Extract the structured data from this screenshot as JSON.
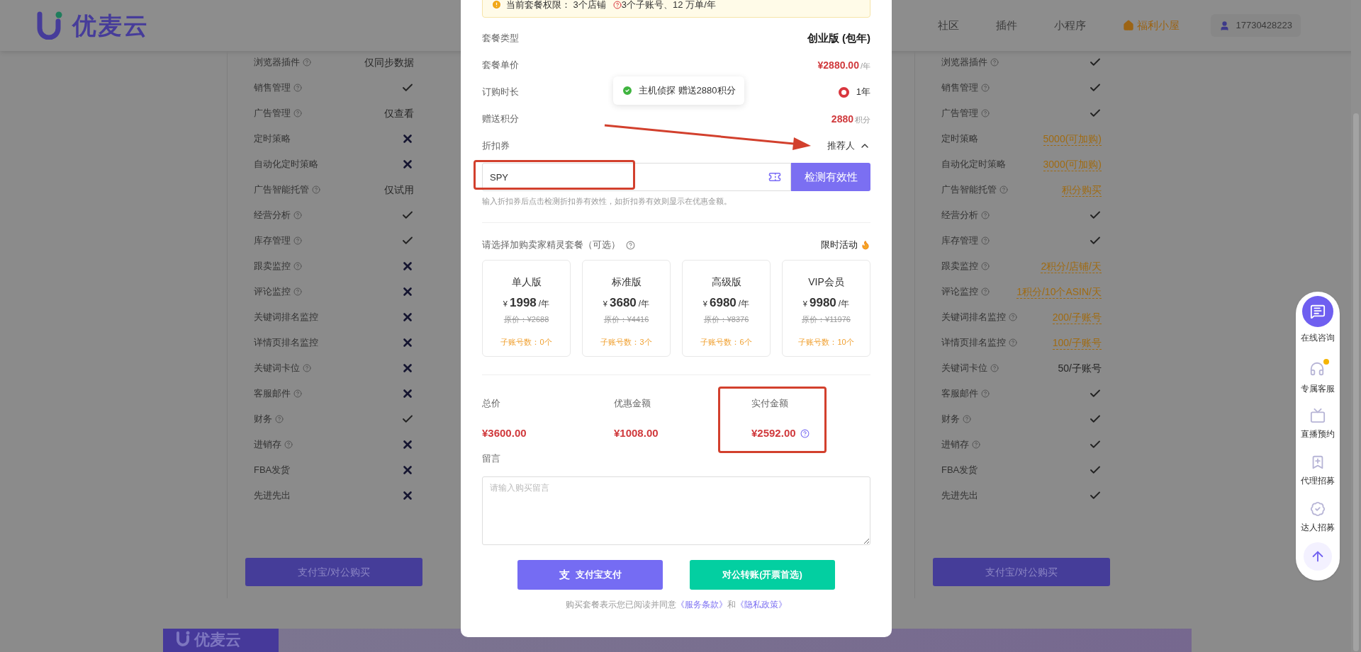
{
  "header": {
    "logo": "优麦云",
    "nav": [
      {
        "label": "社区",
        "kind": "plain"
      },
      {
        "label": "插件",
        "kind": "plain"
      },
      {
        "label": "小程序",
        "kind": "plain"
      },
      {
        "label": "福利小屋",
        "kind": "highlight"
      }
    ],
    "user": "17730428223"
  },
  "plans": [
    {
      "features": [
        {
          "label": "浏览器插件",
          "help": true,
          "kind": "text",
          "value": "仅同步数据"
        },
        {
          "label": "销售管理",
          "help": true,
          "kind": "check"
        },
        {
          "label": "广告管理",
          "help": true,
          "kind": "text",
          "value": "仅查看"
        },
        {
          "label": "定时策略",
          "help": false,
          "kind": "cross"
        },
        {
          "label": "自动化定时策略",
          "help": false,
          "kind": "cross"
        },
        {
          "label": "广告智能托管",
          "help": true,
          "kind": "text",
          "value": "仅试用"
        },
        {
          "label": "经营分析",
          "help": true,
          "kind": "check"
        },
        {
          "label": "库存管理",
          "help": true,
          "kind": "check"
        },
        {
          "label": "跟卖监控",
          "help": true,
          "kind": "cross"
        },
        {
          "label": "评论监控",
          "help": true,
          "kind": "cross"
        },
        {
          "label": "关键词排名监控",
          "help": false,
          "kind": "cross"
        },
        {
          "label": "详情页排名监控",
          "help": false,
          "kind": "cross"
        },
        {
          "label": "关键词卡位",
          "help": true,
          "kind": "cross"
        },
        {
          "label": "客服邮件",
          "help": true,
          "kind": "cross"
        },
        {
          "label": "财务",
          "help": true,
          "kind": "check"
        },
        {
          "label": "进销存",
          "help": true,
          "kind": "cross"
        },
        {
          "label": "FBA发货",
          "help": false,
          "kind": "cross"
        },
        {
          "label": "先进先出",
          "help": false,
          "kind": "cross"
        }
      ],
      "button": "支付宝/对公购买"
    },
    {
      "features": [
        {
          "label": "浏览器插件",
          "help": true,
          "kind": "check"
        },
        {
          "label": "销售管理",
          "help": true,
          "kind": "check"
        },
        {
          "label": "广告管理",
          "help": true,
          "kind": "check"
        },
        {
          "label": "定时策略",
          "help": false,
          "kind": "link",
          "value": "5000(可加购)"
        },
        {
          "label": "自动化定时策略",
          "help": false,
          "kind": "link",
          "value": "3000(可加购)"
        },
        {
          "label": "广告智能托管",
          "help": true,
          "kind": "link",
          "value": "积分购买"
        },
        {
          "label": "经营分析",
          "help": true,
          "kind": "check"
        },
        {
          "label": "库存管理",
          "help": true,
          "kind": "check"
        },
        {
          "label": "跟卖监控",
          "help": true,
          "kind": "link",
          "value": "2积分/店铺/天"
        },
        {
          "label": "评论监控",
          "help": true,
          "kind": "link",
          "value": "1积分/10个ASIN/天"
        },
        {
          "label": "关键词排名监控",
          "help": true,
          "kind": "link",
          "value": "200/子账号"
        },
        {
          "label": "详情页排名监控",
          "help": true,
          "kind": "link",
          "value": "100/子账号"
        },
        {
          "label": "关键词卡位",
          "help": true,
          "kind": "text",
          "value": "50/子账号"
        },
        {
          "label": "客服邮件",
          "help": true,
          "kind": "check"
        },
        {
          "label": "财务",
          "help": true,
          "kind": "check"
        },
        {
          "label": "进销存",
          "help": true,
          "kind": "check"
        },
        {
          "label": "FBA发货",
          "help": false,
          "kind": "check"
        },
        {
          "label": "先进先出",
          "help": false,
          "kind": "check"
        }
      ],
      "button": "支付宝/对公购买"
    }
  ],
  "banner": {
    "logo": "优麦云"
  },
  "modal": {
    "notice": {
      "before": "当前套餐权限： 3个店铺",
      "after": "3个子账号、12 万单/年"
    },
    "rows": [
      {
        "label": "套餐类型",
        "kind": "plain",
        "value": "创业版 (包年)"
      },
      {
        "label": "套餐单价",
        "kind": "price",
        "value": "¥2880.00",
        "unit": "/年"
      },
      {
        "label": "订购时长",
        "kind": "radio",
        "options": [
          {
            "label": "1年",
            "selected": true
          }
        ]
      },
      {
        "label": "赠送积分",
        "kind": "price",
        "value": "2880",
        "unit": "积分"
      }
    ],
    "coupon": {
      "label": "折扣券",
      "referrer": "推荐人",
      "expanded": true,
      "value": "SPY",
      "button": "检测有效性",
      "hint": "输入折扣券后点击检测折扣券有效性，如折扣券有效则显示在优惠金额。"
    },
    "addon": {
      "title": "请选择加购卖家精灵套餐（可选）",
      "promo": "限时活动",
      "packages": [
        {
          "name": "单人版",
          "currency": "¥",
          "price": "1998",
          "unit": "/年",
          "original": "原价：¥2688",
          "accounts": "子账号数：0个",
          "selected": false
        },
        {
          "name": "标准版",
          "currency": "¥",
          "price": "3680",
          "unit": "/年",
          "original": "原价：¥4416",
          "accounts": "子账号数：3个",
          "selected": false
        },
        {
          "name": "高级版",
          "currency": "¥",
          "price": "6980",
          "unit": "/年",
          "original": "原价：¥8376",
          "accounts": "子账号数：6个",
          "selected": false
        },
        {
          "name": "VIP会员",
          "currency": "¥",
          "price": "9980",
          "unit": "/年",
          "original": "原价：¥11976",
          "accounts": "子账号数：10个",
          "selected": false
        }
      ]
    },
    "totals": [
      {
        "label": "总价",
        "value": "¥3600.00",
        "help": false
      },
      {
        "label": "优惠金额",
        "value": "¥1008.00",
        "help": false
      },
      {
        "label": "实付金额",
        "value": "¥2592.00",
        "help": true
      }
    ],
    "message": {
      "label": "留言",
      "placeholder": "请输入购买留言"
    },
    "buttons": [
      {
        "label": "支付宝支付",
        "kind": "alipay",
        "glyph": "支"
      },
      {
        "label": "对公转账(开票首选)",
        "kind": "transfer"
      }
    ],
    "terms": {
      "text": "购买套餐表示您已阅读并同意",
      "link1": "《服务条款》",
      "joiner": "和",
      "link2": "《隐私政策》"
    },
    "toast": {
      "text": "主机侦探 赠送2880积分"
    }
  },
  "side_widget": {
    "items": [
      {
        "label": "在线咨询",
        "kind": "chat"
      },
      {
        "label": "专属客服",
        "kind": "service"
      },
      {
        "label": "直播预约",
        "kind": "live"
      },
      {
        "label": "代理招募",
        "kind": "agent"
      },
      {
        "label": "达人招募",
        "kind": "talent"
      }
    ]
  }
}
